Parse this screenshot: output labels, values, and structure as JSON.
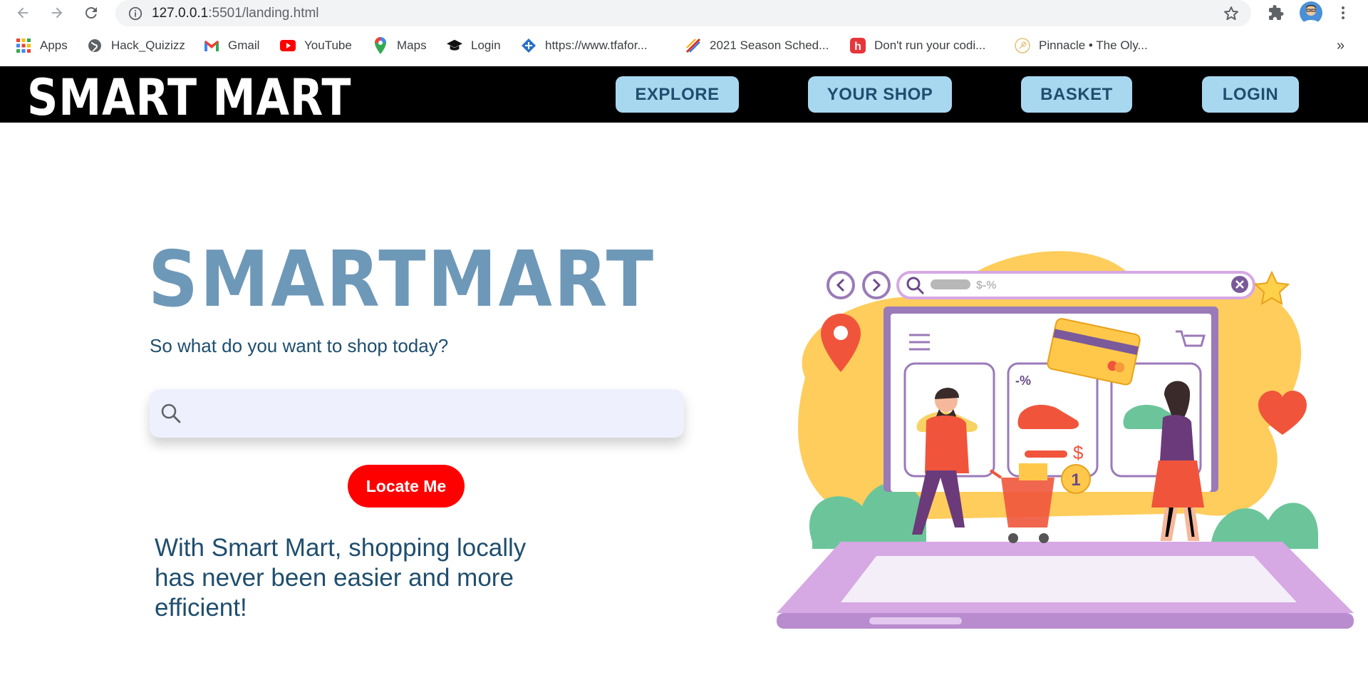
{
  "browser": {
    "url_host": "127.0.0.1",
    "url_rest": ":5501/landing.html",
    "bookmarks": [
      {
        "label": "Apps",
        "icon": "apps-grid-icon"
      },
      {
        "label": "Hack_Quizizz",
        "icon": "globe-icon"
      },
      {
        "label": "Gmail",
        "icon": "gmail-icon"
      },
      {
        "label": "YouTube",
        "icon": "youtube-icon"
      },
      {
        "label": "Maps",
        "icon": "maps-pin-icon"
      },
      {
        "label": "Login",
        "icon": "graduation-cap-icon"
      },
      {
        "label": "https://www.tfafor...",
        "icon": "tfa-icon"
      },
      {
        "label": "2021 Season Sched...",
        "icon": "schedule-icon"
      },
      {
        "label": "Don't run your codi...",
        "icon": "h-icon"
      },
      {
        "label": "Pinnacle • The Oly...",
        "icon": "pinnacle-icon"
      }
    ],
    "overflow": "»"
  },
  "site": {
    "brand": "SMART MART",
    "nav": {
      "explore": "EXPLORE",
      "your_shop": "YOUR SHOP",
      "basket": "BASKET",
      "login": "LOGIN"
    }
  },
  "hero": {
    "title": "SMARTMART",
    "subtitle": "So what do you want to shop today?",
    "search_placeholder": "",
    "locate_button": "Locate Me",
    "tagline": "With Smart Mart, shopping locally has never been easier and more efficient!",
    "illustration_badge": "1",
    "illustration_search_text": "$-%",
    "illustration_discount": "-%",
    "illustration_price": "$"
  },
  "colors": {
    "nav_bg": "#000000",
    "nav_button": "#a8d8f0",
    "hero_title": "#6e98b8",
    "text_dark_blue": "#1f4e6e",
    "locate_button": "#ff0000"
  }
}
